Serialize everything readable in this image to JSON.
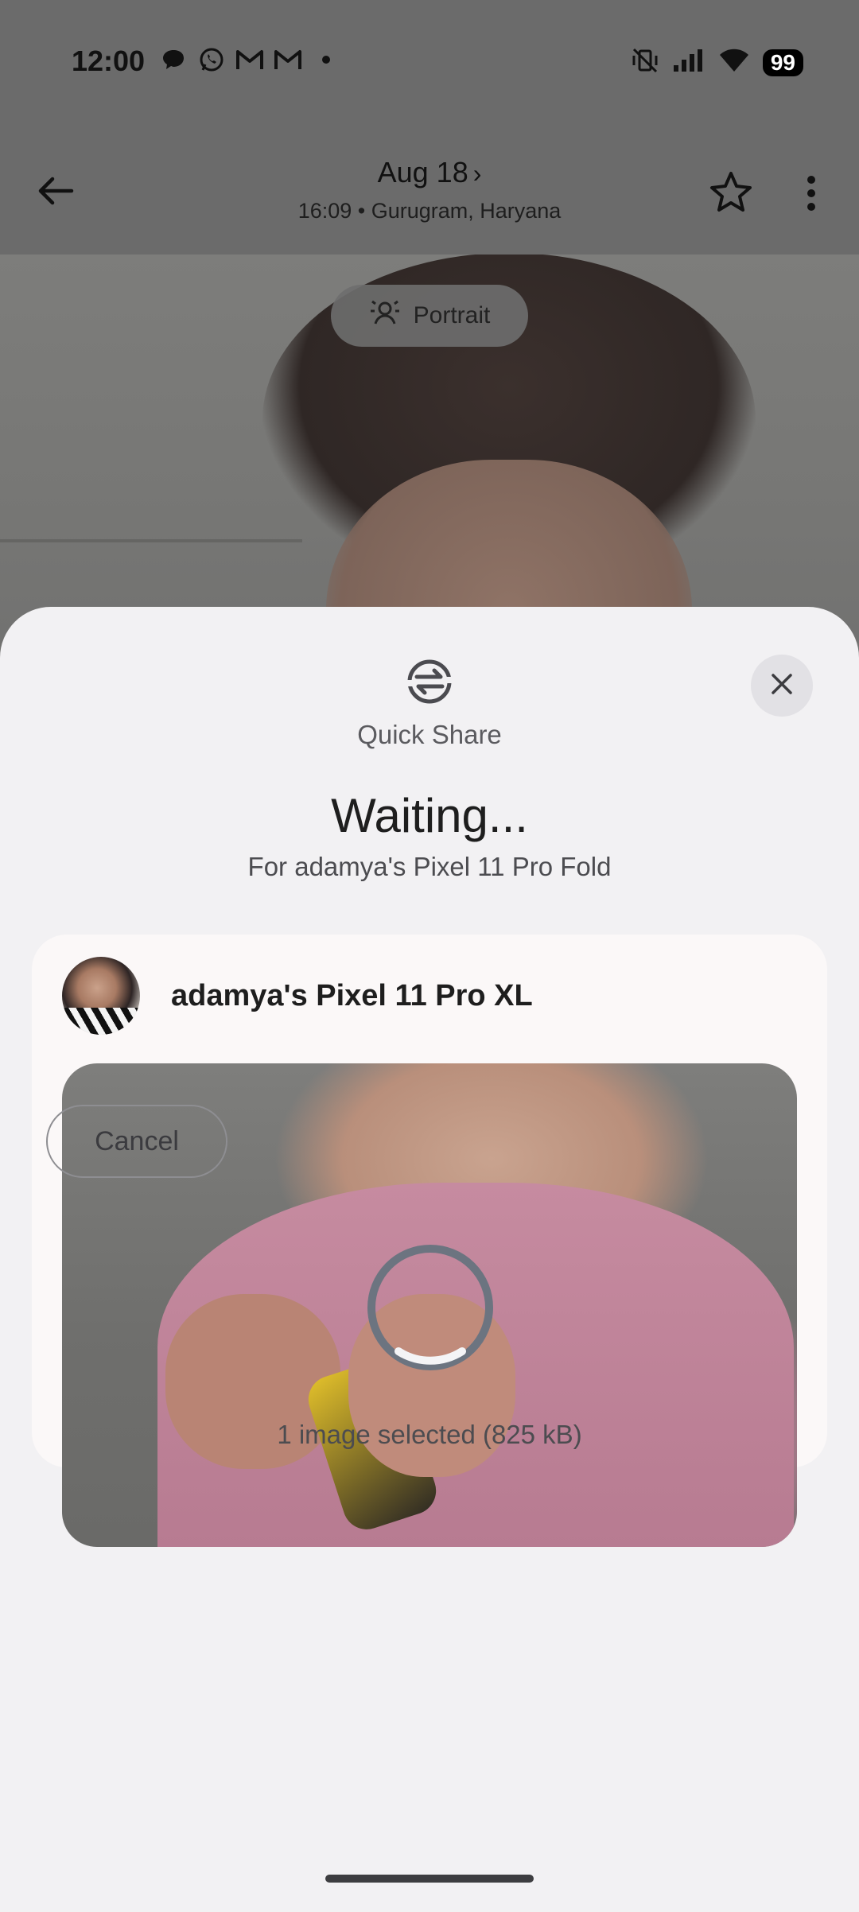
{
  "status_bar": {
    "time": "12:00",
    "battery": "99",
    "left_icons": [
      "chat-bubble-icon",
      "whatsapp-icon",
      "gmail-icon",
      "gmail-icon",
      "dot-icon"
    ],
    "right_icons": [
      "mute-vibrate-icon",
      "signal-icon",
      "wifi-icon",
      "battery-icon"
    ]
  },
  "app_bar": {
    "title": "Aug 18",
    "chevron": "›",
    "subtitle": "16:09 • Gurugram, Haryana"
  },
  "portrait_chip": {
    "label": "Portrait"
  },
  "sheet": {
    "app_label": "Quick Share",
    "heading": "Waiting...",
    "subheading": "For adamya's Pixel 11 Pro Fold",
    "device_name": "adamya's Pixel 11 Pro XL",
    "selection_text": "1 image selected (825 kB)",
    "cancel_label": "Cancel"
  },
  "colors": {
    "sheet_bg": "#f2f1f3",
    "card_bg": "#fbf8f8",
    "scrim": "#6b6b6b"
  }
}
